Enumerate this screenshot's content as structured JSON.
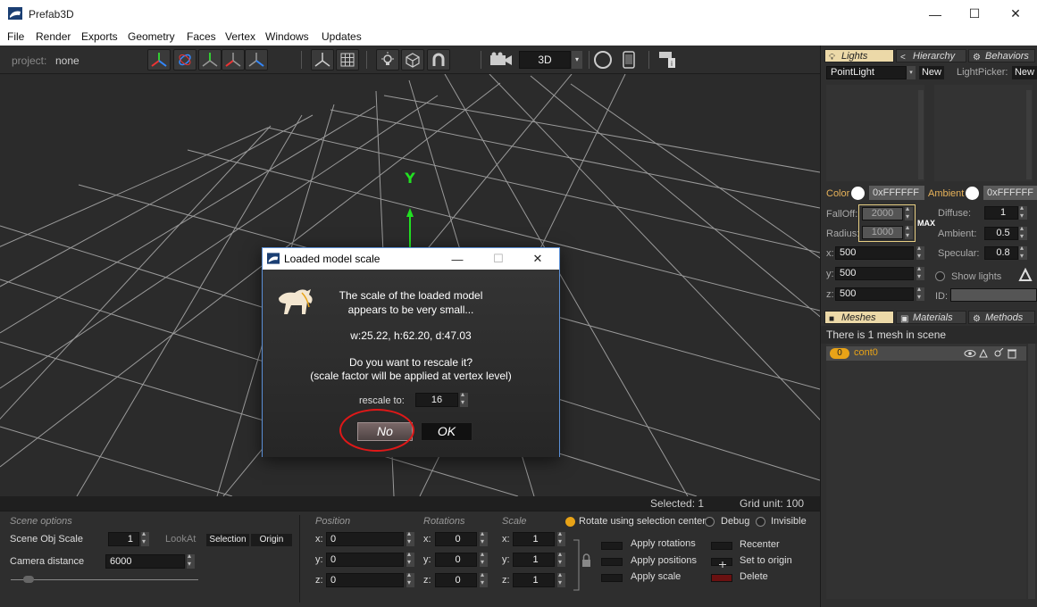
{
  "window": {
    "title": "Prefab3D",
    "minimize": "—",
    "maximize": "☐",
    "close": "✕"
  },
  "menu": [
    "File",
    "Render",
    "Exports",
    "Geometry",
    "Faces",
    "Vertex",
    "Windows",
    "Updates"
  ],
  "toolbar": {
    "project_label": "project:",
    "project_value": "none",
    "view_mode": "3D",
    "view_arrow": "▾"
  },
  "viewport": {
    "axis_label": "Y"
  },
  "status": {
    "selected": "Selected: 1",
    "grid_unit": "Grid unit: 100"
  },
  "bottom": {
    "scene_options_title": "Scene options",
    "scene_obj_scale_label": "Scene Obj Scale",
    "scene_obj_scale_value": "1",
    "lookat_label": "LookAt",
    "lookat_selection": "Selection",
    "lookat_origin": "Origin",
    "camera_distance_label": "Camera distance",
    "camera_distance_value": "6000",
    "position_title": "Position",
    "rotations_title": "Rotations",
    "scale_title": "Scale",
    "axis_x": "x:",
    "axis_y": "y:",
    "axis_z": "z:",
    "position": {
      "x": "0",
      "y": "0",
      "z": "0"
    },
    "rotations": {
      "x": "0",
      "y": "0",
      "z": "0"
    },
    "scale": {
      "x": "1",
      "y": "1",
      "z": "1"
    },
    "rotate_center": "Rotate using selection center",
    "debug": "Debug",
    "invisible": "Invisible",
    "apply_rotations": "Apply rotations",
    "apply_positions": "Apply positions",
    "apply_scale": "Apply scale",
    "recenter": "Recenter",
    "set_to_origin": "Set to origin",
    "delete": "Delete"
  },
  "rpanel": {
    "tabs": {
      "lights": "Lights",
      "hierarchy": "Hierarchy",
      "behaviors": "Behaviors"
    },
    "light_type": "PointLight",
    "new_label": "New",
    "lightpicker_label": "LightPicker:",
    "color_label": "Color",
    "color_hex": "0xFFFFFF",
    "ambient_color_label": "Ambient",
    "ambient_hex": "0xFFFFFF",
    "falloff_label": "FallOff:",
    "falloff_value": "2000",
    "radius_label": "Radius:",
    "radius_value": "1000",
    "max_label": "MAX",
    "diffuse_label": "Diffuse:",
    "diffuse_value": "1",
    "ambient_label": "Ambient:",
    "ambient_value": "0.5",
    "specular_label": "Specular:",
    "specular_value": "0.8",
    "x_label": "x:",
    "x_value": "500",
    "y_label": "y:",
    "y_value": "500",
    "z_label": "z:",
    "z_value": "500",
    "show_lights": "Show lights",
    "id_label": "ID:",
    "mesh_tabs": {
      "meshes": "Meshes",
      "materials": "Materials",
      "methods": "Methods"
    },
    "mesh_count_text": "There is 1 mesh in scene",
    "mesh_index": "0",
    "mesh_name": "cont0"
  },
  "dialog": {
    "title": "Loaded model scale",
    "line1": "The scale of the loaded model",
    "line2": "appears to be very small...",
    "dims": "w:25.22, h:62.20, d:47.03",
    "question": "Do you want to rescale it?",
    "note": "(scale factor will be applied at vertex level)",
    "rescale_label": "rescale to:",
    "rescale_value": "16",
    "no_label": "No",
    "ok_label": "OK"
  },
  "colors": {
    "accent": "#e8a317",
    "highlight_ring": "#e01818",
    "axis_green": "#22e022"
  }
}
